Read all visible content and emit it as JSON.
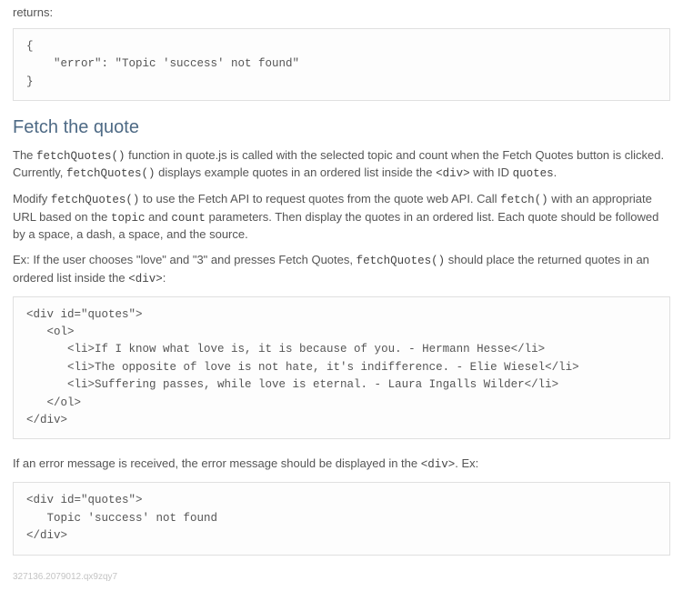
{
  "intro_returns": "returns:",
  "code_block_1": "{\n    \"error\": \"Topic 'success' not found\"\n}",
  "heading_fetch": "Fetch the quote",
  "para1_seg": {
    "a": "The ",
    "b": "fetchQuotes()",
    "c": " function in quote.js is called with the selected topic and count when the Fetch Quotes button is clicked. Currently, ",
    "d": "fetchQuotes()",
    "e": " displays example quotes in an ordered list inside the ",
    "f": "<div>",
    "g": " with ID ",
    "h": "quotes",
    "i": "."
  },
  "para2_seg": {
    "a": "Modify ",
    "b": "fetchQuotes()",
    "c": " to use the Fetch API to request quotes from the quote web API. Call ",
    "d": "fetch()",
    "e": " with an appropriate URL based on the ",
    "f": "topic",
    "g": " and ",
    "h": "count",
    "i": " parameters. Then display the quotes in an ordered list. Each quote should be followed by a space, a dash, a space, and the source."
  },
  "para3_seg": {
    "a": "Ex: If the user chooses \"love\" and \"3\" and presses Fetch Quotes, ",
    "b": "fetchQuotes()",
    "c": " should place the returned quotes in an ordered list inside the ",
    "d": "<div>",
    "e": ":"
  },
  "code_block_2": "<div id=\"quotes\">\n   <ol>\n      <li>If I know what love is, it is because of you. - Hermann Hesse</li>\n      <li>The opposite of love is not hate, it's indifference. - Elie Wiesel</li>\n      <li>Suffering passes, while love is eternal. - Laura Ingalls Wilder</li>\n   </ol>\n</div>",
  "para4_seg": {
    "a": "If an error message is received, the error message should be displayed in the ",
    "b": "<div>",
    "c": ". Ex:"
  },
  "code_block_3": "<div id=\"quotes\">\n   Topic 'success' not found\n</div>",
  "footer_id": "327136.2079012.qx9zqy7"
}
